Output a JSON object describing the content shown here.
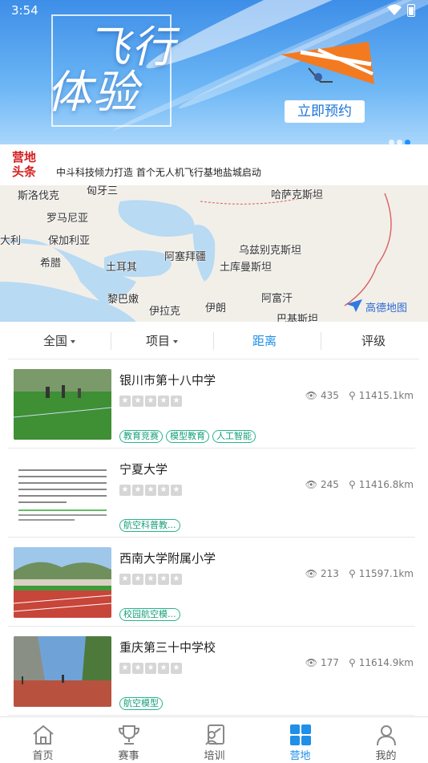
{
  "status": {
    "time": "3:54"
  },
  "banner": {
    "title_line1": "飞行",
    "title_line2": "体验",
    "cta": "立即预约",
    "dots": 3,
    "active_dot": 2
  },
  "news": {
    "tag_line1": "营地",
    "tag_line2": "头条",
    "text": "中斗科技倾力打造 首个无人机飞行基地盐城启动"
  },
  "map": {
    "labels": [
      "斯洛伐克",
      "匈牙三",
      "哈萨克斯坦",
      "罗马尼亚",
      "大利",
      "保加利亚",
      "乌兹别克斯坦",
      "阿塞拜疆",
      "希腊",
      "土耳其",
      "土库曼斯坦",
      "黎巴嫩",
      "阿富汗",
      "伊拉克",
      "伊朗",
      "巴基斯坦"
    ],
    "provider": "高德地图"
  },
  "filters": {
    "region": "全国",
    "project": "项目",
    "distance": "距离",
    "rating": "评级"
  },
  "camps": [
    {
      "name": "银川市第十八中学",
      "views": "435",
      "distance": "11415.1km",
      "tags": [
        "教育竞赛",
        "模型教育",
        "人工智能"
      ]
    },
    {
      "name": "宁夏大学",
      "views": "245",
      "distance": "11416.8km",
      "tags": [
        "航空科普教..."
      ]
    },
    {
      "name": "西南大学附属小学",
      "views": "213",
      "distance": "11597.1km",
      "tags": [
        "校园航空模..."
      ]
    },
    {
      "name": "重庆第三十中学校",
      "views": "177",
      "distance": "11614.9km",
      "tags": [
        "航空模型"
      ]
    }
  ],
  "tabs": [
    {
      "label": "首页",
      "icon": "home-icon"
    },
    {
      "label": "赛事",
      "icon": "trophy-icon"
    },
    {
      "label": "培训",
      "icon": "training-icon"
    },
    {
      "label": "营地",
      "icon": "camp-grid-icon"
    },
    {
      "label": "我的",
      "icon": "profile-icon"
    }
  ],
  "colors": {
    "accent": "#1f8fe8",
    "tag_green": "#18a07a",
    "news_red": "#d61f1f"
  }
}
